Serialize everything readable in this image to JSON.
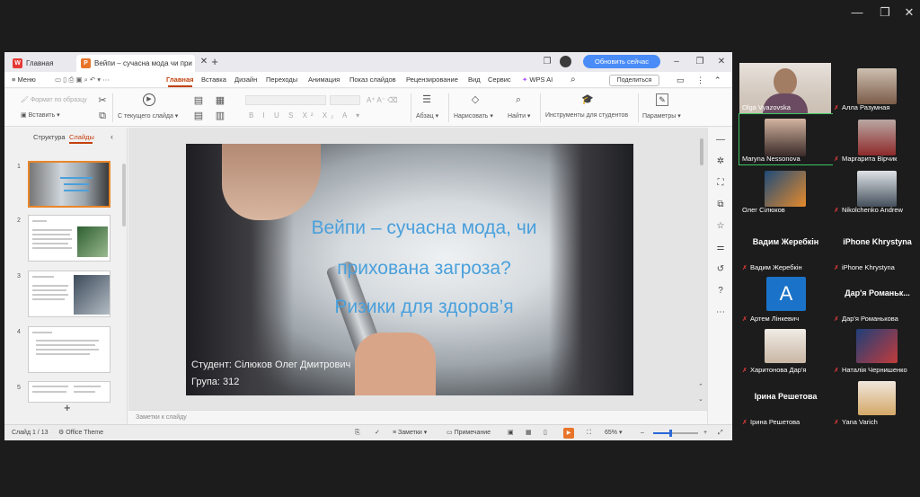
{
  "window": {
    "minimize": "—",
    "maximize": "❐",
    "close": "✕"
  },
  "app": {
    "tabs": [
      {
        "label": "Главная",
        "icon": "W"
      },
      {
        "label": "Вейпи – сучасна мода чи при",
        "icon": "P"
      }
    ],
    "update_button": "Обновить сейчас",
    "menu": {
      "main_menu": "Меню",
      "items": [
        "Главная",
        "Вставка",
        "Дизайн",
        "Переходы",
        "Анимация",
        "Показ слайдов",
        "Рецензирование",
        "Вид",
        "Сервис"
      ],
      "wps_ai": "WPS AI",
      "share": "Поделиться"
    },
    "ribbon": {
      "format_painter": "Формат по образцу",
      "paste": "Вставить",
      "from_current": "С текущего слайда",
      "paragraph": "Абзац",
      "draw": "Нарисовать",
      "find": "Найти",
      "student_tools": "Инструменты для студентов",
      "parameters": "Параметры"
    },
    "left_pane": {
      "tab_outline": "Структура",
      "tab_slides": "Слайды",
      "slide_numbers": [
        "1",
        "2",
        "3",
        "4",
        "5"
      ],
      "add": "+"
    },
    "slide": {
      "title_lines": [
        "Вейпи – сучасна мода, чи",
        "прихована загроза?",
        "Ризики для здоров’я"
      ],
      "student": "Студент: Сілюков Олег Дмитрович",
      "group": "Група: 312",
      "title_color": "#4aa0dc"
    },
    "notes_placeholder": "Заметки к слайду",
    "status": {
      "slide_counter": "Слайд 1 / 13",
      "theme": "Office Theme",
      "notes": "Заметки",
      "comments": "Примечание",
      "zoom": "65%"
    },
    "accent": "#c2410c"
  },
  "participants": [
    {
      "name": "Olga Vyazovska",
      "muted": false,
      "video": true,
      "highlight": false
    },
    {
      "name": "Алла Разумная",
      "muted": true,
      "video": true,
      "highlight": false
    },
    {
      "name": "Maryna Nessonova",
      "muted": false,
      "video": true,
      "highlight": true
    },
    {
      "name": "Маргарита Вірчик",
      "muted": true,
      "video": true,
      "highlight": false
    },
    {
      "name": "Олег Сілюков",
      "muted": false,
      "video": true,
      "highlight": false
    },
    {
      "name": "Nikolchenko Andrew",
      "muted": true,
      "video": true,
      "highlight": false
    },
    {
      "name": "Вадим Жеребкін",
      "display": "Вадим Жеребкін",
      "muted": true,
      "video": false,
      "highlight": false
    },
    {
      "name": "iPhone Khrystyna",
      "display": "iPhone Khrystyna",
      "muted": true,
      "video": false,
      "highlight": false
    },
    {
      "name": "Артем Лінкевич",
      "avatar_letter": "A",
      "muted": true,
      "video": false,
      "highlight": false
    },
    {
      "name": "Дар'я Романькова",
      "display": "Дар'я Романьк...",
      "muted": true,
      "video": false,
      "highlight": false
    },
    {
      "name": "Харитонова Дар'я",
      "muted": true,
      "video": true,
      "highlight": false
    },
    {
      "name": "Наталія Чернишенко",
      "muted": true,
      "video": true,
      "highlight": false
    },
    {
      "name": "Ірина Решетова",
      "display": "Ірина Решетова",
      "muted": true,
      "video": false,
      "highlight": false
    },
    {
      "name": "Yana Varich",
      "muted": true,
      "video": true,
      "highlight": false
    }
  ]
}
